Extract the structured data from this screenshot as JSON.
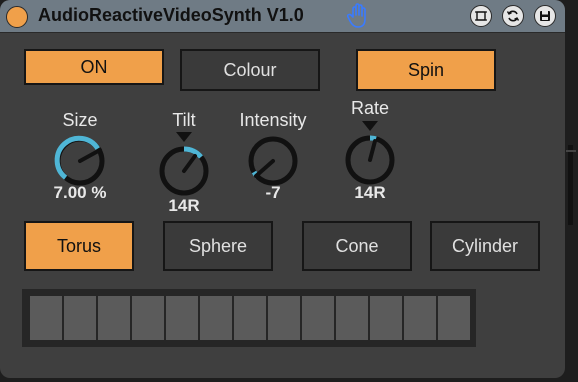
{
  "window": {
    "title": "AudioReactiveVideoSynth V1.0",
    "icons": [
      "power-dot",
      "hand-icon",
      "fit-icon",
      "refresh-icon",
      "save-icon"
    ],
    "accent_color": "#f0a04a",
    "dial_accent_color": "#4fb6d6"
  },
  "toggles": [
    {
      "label": "ON",
      "active": true
    },
    {
      "label": "Colour",
      "active": false
    },
    {
      "label": "Spin",
      "active": true
    }
  ],
  "dials": [
    {
      "label": "Size",
      "value": "7.00 %"
    },
    {
      "label": "Tilt",
      "value": "14R"
    },
    {
      "label": "Intensity",
      "value": "-7"
    },
    {
      "label": "Rate",
      "value": "14R"
    }
  ],
  "shapes": [
    {
      "label": "Torus",
      "active": true
    },
    {
      "label": "Sphere",
      "active": false
    },
    {
      "label": "Cone",
      "active": false
    },
    {
      "label": "Cylinder",
      "active": false
    }
  ],
  "meter": {
    "cells": 13,
    "lit": 0
  }
}
